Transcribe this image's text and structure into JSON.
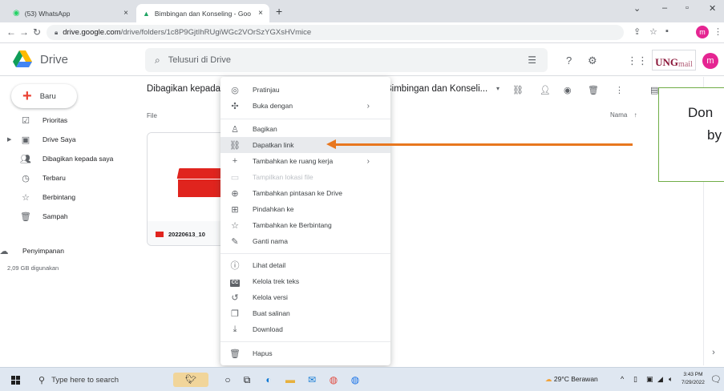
{
  "browser": {
    "tabs": [
      {
        "title": "(53) WhatsApp",
        "close": "×"
      },
      {
        "title": "Bimbingan dan Konseling - Goo",
        "close": "×"
      }
    ],
    "new_tab": "+",
    "url": {
      "host": "drive.google.com",
      "path": "/drive/folders/1c8P9GjtIhRUgiWGc2VOrSzYGXsHVmice"
    }
  },
  "drive": {
    "title": "Drive",
    "search_placeholder": "Telusuri di Drive",
    "avatar_letter": "m",
    "ung_logo_text": "UNG",
    "ung_logo_sub": "mail"
  },
  "sidebar": {
    "new_label": "Baru",
    "items": [
      {
        "label": "Prioritas",
        "icon": "check-square-icon"
      },
      {
        "label": "Drive Saya",
        "icon": "drive-icon"
      },
      {
        "label": "Dibagikan kepada saya",
        "icon": "people-icon"
      },
      {
        "label": "Terbaru",
        "icon": "clock-icon"
      },
      {
        "label": "Berbintang",
        "icon": "star-icon"
      },
      {
        "label": "Sampah",
        "icon": "trash-icon"
      },
      {
        "label": "Penyimpanan",
        "icon": "cloud-icon"
      }
    ],
    "storage_used": "2,09 GB digunakan"
  },
  "main": {
    "breadcrumb_shared": "Dibagikan kepada",
    "breadcrumb_folder": "Bimbingan dan Konseli...",
    "file_section": "File",
    "sort_label": "Nama",
    "file_name": "20220613_10"
  },
  "context_menu": {
    "items": [
      {
        "label": "Pratinjau",
        "icon": "eye-icon"
      },
      {
        "label": "Buka dengan",
        "icon": "open-with-icon",
        "submenu": true
      },
      {
        "label": "Bagikan",
        "icon": "add-person-icon"
      },
      {
        "label": "Dapatkan link",
        "icon": "link-icon",
        "highlighted": true
      },
      {
        "label": "Tambahkan ke ruang kerja",
        "icon": "plus-icon",
        "submenu": true
      },
      {
        "label": "Tampilkan lokasi file",
        "icon": "folder-icon",
        "disabled": true
      },
      {
        "label": "Tambahkan pintasan ke Drive",
        "icon": "shortcut-icon"
      },
      {
        "label": "Pindahkan ke",
        "icon": "move-icon"
      },
      {
        "label": "Tambahkan ke Berbintang",
        "icon": "star-icon"
      },
      {
        "label": "Ganti nama",
        "icon": "pencil-icon"
      },
      {
        "label": "Lihat detail",
        "icon": "info-icon"
      },
      {
        "label": "Kelola trek teks",
        "icon": "cc-icon"
      },
      {
        "label": "Kelola versi",
        "icon": "history-icon"
      },
      {
        "label": "Buat salinan",
        "icon": "copy-icon"
      },
      {
        "label": "Download",
        "icon": "download-icon"
      },
      {
        "label": "Hapus",
        "icon": "trash-icon"
      }
    ]
  },
  "annotation": {
    "line1": "Don",
    "line2": "by",
    "arrow_color": "#e8771f",
    "border_color": "#70ad47"
  },
  "taskbar": {
    "search_placeholder": "Type here to search",
    "weather": "29°C Berawan",
    "time": "3:43 PM",
    "date": "7/29/2022"
  }
}
